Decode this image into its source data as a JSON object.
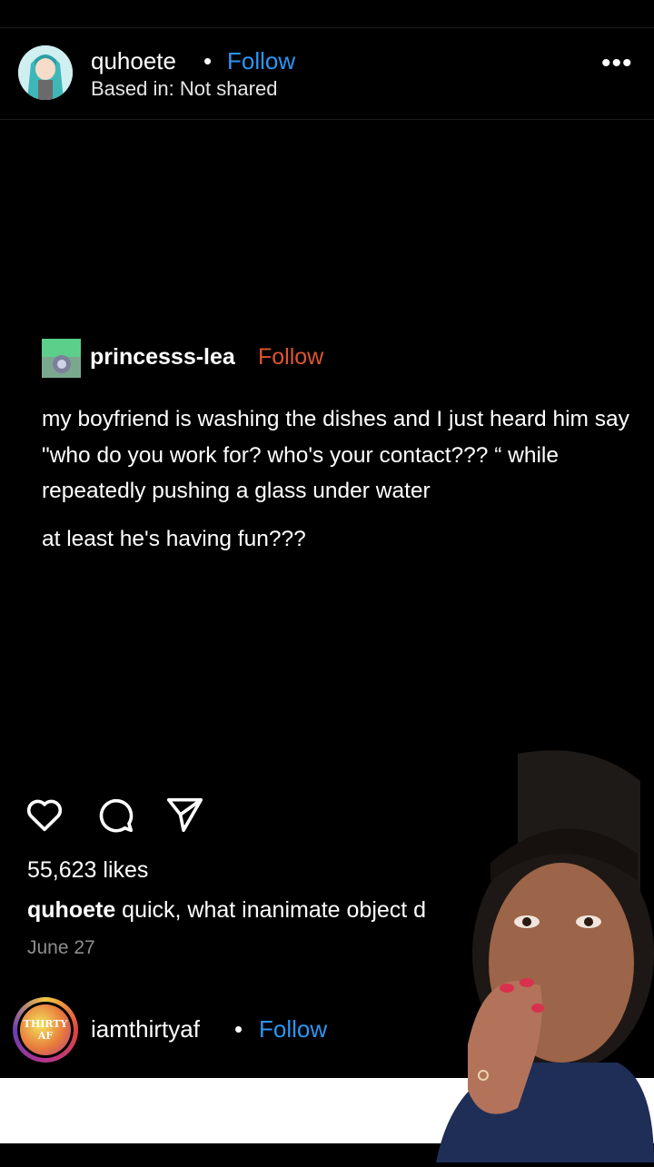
{
  "post_header": {
    "username": "quhoete",
    "separator": "•",
    "follow_label": "Follow",
    "location": "Based in: Not shared",
    "more_label": "•••"
  },
  "embedded_post": {
    "username": "princesss-lea",
    "follow_label": "Follow",
    "text": "my boyfriend is washing the dishes and I just heard him say \"who do you work for? who's your contact??? “ while repeatedly pushing a glass under water",
    "text2": "at least he's having fun???"
  },
  "actions": {
    "like_icon": "heart-icon",
    "comment_icon": "comment-icon",
    "share_icon": "send-icon"
  },
  "stats": {
    "likes": "55,623 likes",
    "caption_user": "quhoete",
    "caption_text": "quick, what inanimate object d",
    "date": "June 27"
  },
  "next_post": {
    "username": "iamthirtyaf",
    "separator": "•",
    "follow_label": "Follow",
    "avatar_text": "THIRTY AF"
  },
  "colors": {
    "follow_blue": "#2a96f5",
    "tumblr_follow": "#e0552e",
    "background": "#000000"
  }
}
